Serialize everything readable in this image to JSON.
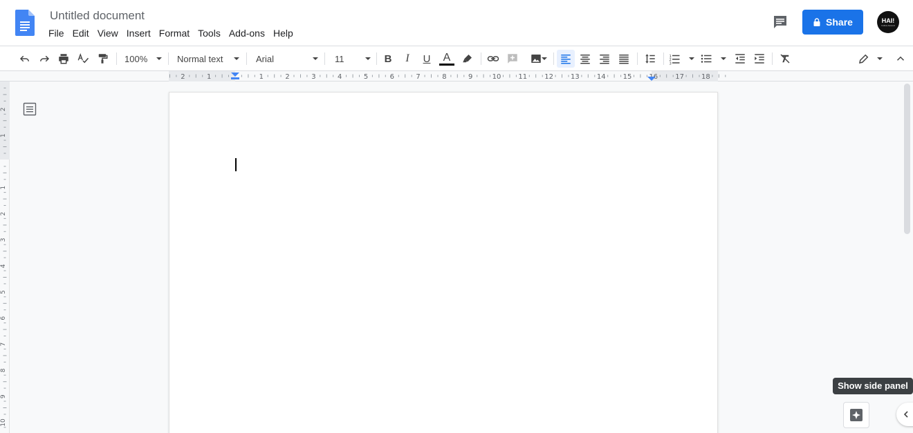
{
  "document": {
    "title": "Untitled document"
  },
  "menu": [
    {
      "label": "File"
    },
    {
      "label": "Edit"
    },
    {
      "label": "View"
    },
    {
      "label": "Insert"
    },
    {
      "label": "Format"
    },
    {
      "label": "Tools"
    },
    {
      "label": "Add-ons"
    },
    {
      "label": "Help"
    }
  ],
  "header": {
    "share_label": "Share",
    "avatar_text": "HAI!",
    "avatar_subtext": "hollow Ascend"
  },
  "toolbar": {
    "zoom": "100%",
    "style": "Normal text",
    "font": "Arial",
    "font_size": "11",
    "bold": "B",
    "italic": "I",
    "underline": "U",
    "text_color_letter": "A",
    "text_color": "#000000",
    "active_alignment": "left"
  },
  "ruler": {
    "left_numbers": [
      "2",
      "1"
    ],
    "right_numbers": [
      "1",
      "2",
      "3",
      "4",
      "5",
      "6",
      "7",
      "8",
      "9",
      "10",
      "11",
      "12",
      "13",
      "14",
      "15",
      "16",
      "17",
      "18"
    ],
    "vertical_top_numbers": [
      "2",
      "1"
    ],
    "vertical_numbers": [
      "1",
      "2",
      "3",
      "4",
      "5",
      "6",
      "7",
      "8",
      "9",
      "10"
    ]
  },
  "side_panel": {
    "tooltip": "Show side panel"
  },
  "colors": {
    "accent": "#1a73e8",
    "background": "#f8f9fa",
    "page": "#ffffff"
  },
  "icons": {
    "undo": "undo-icon",
    "redo": "redo-icon",
    "print": "print-icon",
    "spellcheck": "spellcheck-icon",
    "paint_format": "paint-format-icon",
    "link": "link-icon",
    "comment": "add-comment-icon",
    "image": "insert-image-icon",
    "line_spacing": "line-spacing-icon",
    "numbered_list": "numbered-list-icon",
    "bulleted_list": "bulleted-list-icon",
    "clear_format": "clear-formatting-icon",
    "editing_mode": "pencil-icon"
  }
}
